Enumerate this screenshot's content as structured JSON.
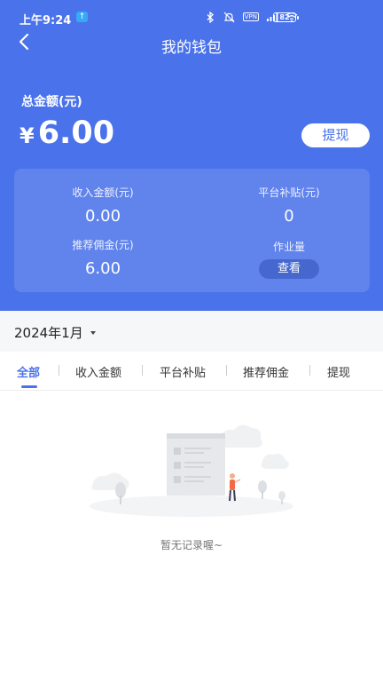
{
  "status_bar": {
    "time": "上午9:24",
    "upload_glyph": "↑",
    "vpn": "VPN",
    "battery": "82",
    "icons": [
      "bluetooth-icon",
      "mute-bell-icon",
      "vpn-icon",
      "signal-icon",
      "wifi-icon",
      "battery-icon"
    ]
  },
  "nav": {
    "title": "我的钱包",
    "back_icon": "chevron-left-icon"
  },
  "wallet": {
    "total_label": "总金额(元)",
    "currency": "¥",
    "amount": "6.00",
    "withdraw_label": "提现"
  },
  "stats": {
    "income_label": "收入金额(元)",
    "income_value": "0.00",
    "subsidy_label": "平台补贴(元)",
    "subsidy_value": "0",
    "commission_label": "推荐佣金(元)",
    "commission_value": "6.00",
    "workload_label": "作业量",
    "view_label": "查看"
  },
  "filter": {
    "month": "2024年1月"
  },
  "tabs": [
    {
      "label": "全部",
      "active": true
    },
    {
      "label": "收入金额",
      "active": false
    },
    {
      "label": "平台补贴",
      "active": false
    },
    {
      "label": "推荐佣金",
      "active": false
    },
    {
      "label": "提现",
      "active": false
    }
  ],
  "empty": {
    "text": "暂无记录喔~"
  },
  "colors": {
    "primary": "#4a72ea",
    "background": "#ffffff",
    "filter_bg": "#f6f7f9"
  }
}
